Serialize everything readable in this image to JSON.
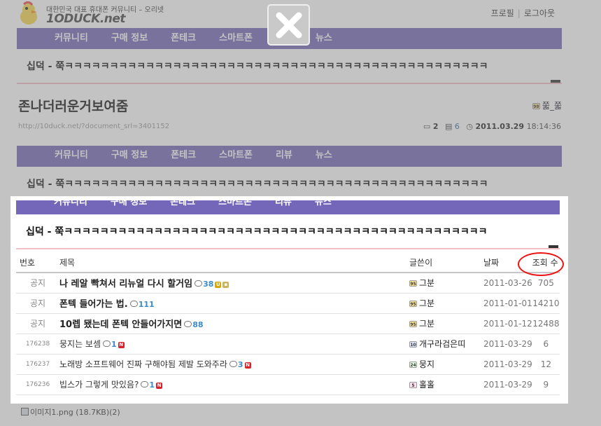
{
  "site": {
    "tagline": "대한민국 대표 휴대폰 커뮤니티 – 오리넷",
    "brand": "1ODUCK.net",
    "top_links": [
      "프로필",
      "로그아웃"
    ]
  },
  "nav": {
    "items": [
      "커뮤니티",
      "구매 정보",
      "폰테크",
      "스마트폰",
      "리뷰",
      "뉴스"
    ]
  },
  "marquee_text": "십덕 - 쭉ㅋㅋㅋㅋㅋㅋㅋㅋㅋㅋㅋㅋㅋㅋㅋㅋㅋㅋㅋㅋㅋㅋㅋㅋㅋㅋㅋㅋㅋㅋㅋㅋㅋㅋㅋㅋㅋㅋㅋㅋㅋㅋㅋㅋㅋㅋㅋ",
  "document": {
    "title": "존나더러운거보여줌",
    "author": "쭓_쭓",
    "url": "http://10duck.net/?document_srl=3401152",
    "comments": "2",
    "trackbacks": "6",
    "date": "2011.03.29",
    "time": "18:14:36"
  },
  "board": {
    "headers": {
      "no": "번호",
      "title": "제목",
      "writer": "글쓴이",
      "date": "날짜",
      "views": "조회 수"
    },
    "rows": [
      {
        "no": "공지",
        "title": "나 레알 빡쳐서 리뉴얼 다시 할거임",
        "comments": "38",
        "writer": "그분",
        "date": "2011-03-26",
        "views": "705"
      },
      {
        "no": "공지",
        "title": "폰텍 들어가는 법.",
        "comments": "111",
        "writer": "그분",
        "date": "2011-01-01",
        "views": "14210"
      },
      {
        "no": "공지",
        "title": "10렙 됐는데 폰텍 안들어가지면",
        "comments": "88",
        "writer": "그분",
        "date": "2011-01-12",
        "views": "12488"
      },
      {
        "no": "176238",
        "title": "뭉지는 보셈",
        "comments": "1",
        "writer": "개구라검은띠",
        "date": "2011-03-29",
        "views": "6"
      },
      {
        "no": "176237",
        "title": "노래방 소프트웨어 진짜 구해야됨 제발 도와주라",
        "comments": "3",
        "writer": "뭉지",
        "date": "2011-03-29",
        "views": "12"
      },
      {
        "no": "176236",
        "title": "빕스가 그렇게 맛있음?",
        "comments": "1",
        "writer": "홀홀",
        "date": "2011-03-29",
        "views": "9"
      }
    ]
  },
  "attachment": {
    "label": "이미지1.png (18.7KB)(2)"
  },
  "colors": {
    "nav": "#7466b8",
    "highlight": "#e11111",
    "comment_count": "#3b8bc7",
    "new_badge": "#d8232a"
  },
  "icons": [
    "duck-logo-icon",
    "close-icon",
    "comment-icon",
    "trackback-icon",
    "clock-icon",
    "level-icon",
    "new-badge-icon",
    "file-icon"
  ]
}
